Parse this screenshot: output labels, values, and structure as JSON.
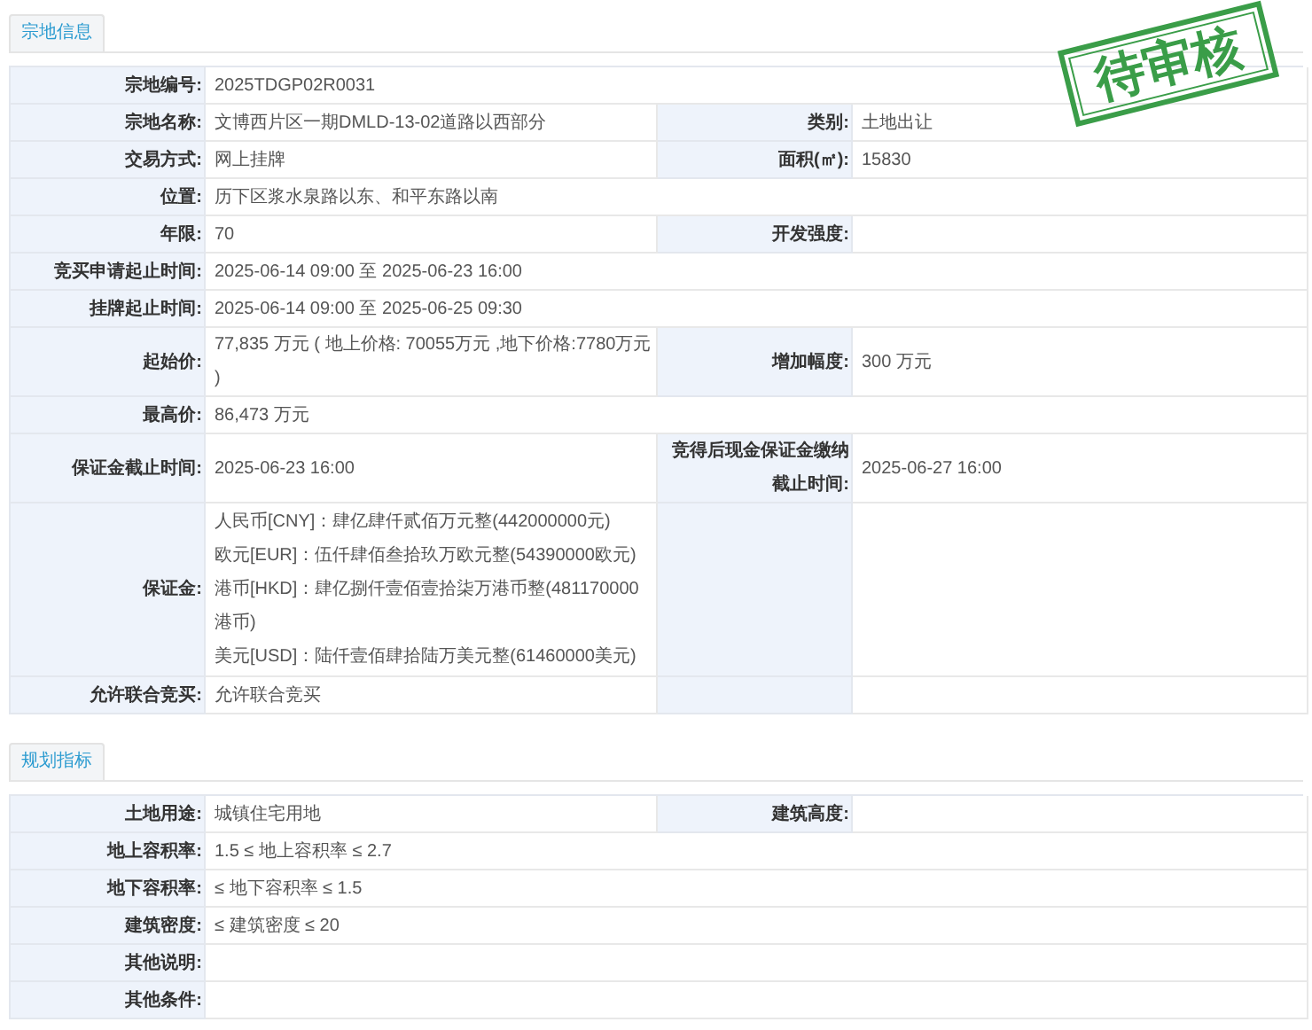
{
  "stamp": "待审核",
  "sections": [
    {
      "title": "宗地信息",
      "rows": [
        {
          "kind": "wide",
          "label": "宗地编号:",
          "value": "2025TDGP02R0031"
        },
        {
          "kind": "pair",
          "label": "宗地名称:",
          "value": "文博西片区一期DMLD-13-02道路以西部分",
          "label2": "类别:",
          "value2": "土地出让"
        },
        {
          "kind": "pair",
          "label": "交易方式:",
          "value": "网上挂牌",
          "label2": "面积(㎡):",
          "value2": "15830"
        },
        {
          "kind": "wide",
          "label": "位置:",
          "value": "历下区浆水泉路以东、和平东路以南"
        },
        {
          "kind": "pair",
          "label": "年限:",
          "value": "70",
          "label2": "开发强度:"
        },
        {
          "kind": "wide",
          "label": "竞买申请起止时间:",
          "value": "2025-06-14 09:00 至 2025-06-23 16:00"
        },
        {
          "kind": "wide",
          "label": "挂牌起止时间:",
          "value": "2025-06-14 09:00 至 2025-06-25 09:30"
        },
        {
          "kind": "pair",
          "label": "起始价:",
          "value": "77,835 万元 ( 地上价格: 70055万元 ,地下价格:7780万元 )",
          "label2": "增加幅度:",
          "value2": "300 万元"
        },
        {
          "kind": "wide",
          "label": "最高价:",
          "value": "86,473 万元"
        },
        {
          "kind": "pair",
          "label": "保证金截止时间:",
          "value": "2025-06-23 16:00",
          "label2": "竞得后现金保证金缴纳截止时间:",
          "value2": "2025-06-27 16:00"
        },
        {
          "kind": "pair",
          "label": "保证金:",
          "lines": [
            "人民币[CNY]：肆亿肆仟贰佰万元整(442000000元)",
            "欧元[EUR]：伍仟肆佰叁拾玖万欧元整(54390000欧元)",
            "港币[HKD]：肆亿捌仟壹佰壹拾柒万港币整(481170000港币)",
            "美元[USD]：陆仟壹佰肆拾陆万美元整(61460000美元)"
          ]
        },
        {
          "kind": "pair",
          "label": "允许联合竞买:",
          "value": "允许联合竞买"
        }
      ]
    },
    {
      "title": "规划指标",
      "rows": [
        {
          "kind": "pair",
          "label": "土地用途:",
          "value": "城镇住宅用地",
          "label2": "建筑高度:"
        },
        {
          "kind": "wide",
          "label": "地上容积率:",
          "value": "1.5 ≤ 地上容积率 ≤ 2.7"
        },
        {
          "kind": "wide",
          "label": "地下容积率:",
          "value": "≤ 地下容积率 ≤ 1.5"
        },
        {
          "kind": "wide",
          "label": "建筑密度:",
          "value": "≤ 建筑密度 ≤ 20"
        },
        {
          "kind": "wide",
          "label": "其他说明:"
        },
        {
          "kind": "wide",
          "label": "其他条件:"
        }
      ]
    }
  ]
}
